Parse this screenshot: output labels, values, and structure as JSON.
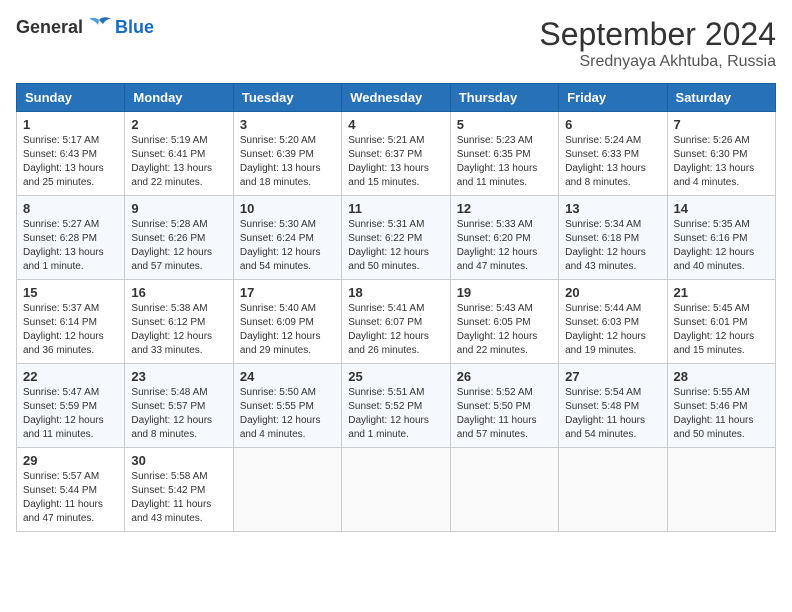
{
  "header": {
    "logo_general": "General",
    "logo_blue": "Blue",
    "month_title": "September 2024",
    "location": "Srednyaya Akhtuba, Russia"
  },
  "days_of_week": [
    "Sunday",
    "Monday",
    "Tuesday",
    "Wednesday",
    "Thursday",
    "Friday",
    "Saturday"
  ],
  "weeks": [
    [
      {
        "day": "1",
        "sunrise": "5:17 AM",
        "sunset": "6:43 PM",
        "daylight": "13 hours and 25 minutes."
      },
      {
        "day": "2",
        "sunrise": "5:19 AM",
        "sunset": "6:41 PM",
        "daylight": "13 hours and 22 minutes."
      },
      {
        "day": "3",
        "sunrise": "5:20 AM",
        "sunset": "6:39 PM",
        "daylight": "13 hours and 18 minutes."
      },
      {
        "day": "4",
        "sunrise": "5:21 AM",
        "sunset": "6:37 PM",
        "daylight": "13 hours and 15 minutes."
      },
      {
        "day": "5",
        "sunrise": "5:23 AM",
        "sunset": "6:35 PM",
        "daylight": "13 hours and 11 minutes."
      },
      {
        "day": "6",
        "sunrise": "5:24 AM",
        "sunset": "6:33 PM",
        "daylight": "13 hours and 8 minutes."
      },
      {
        "day": "7",
        "sunrise": "5:26 AM",
        "sunset": "6:30 PM",
        "daylight": "13 hours and 4 minutes."
      }
    ],
    [
      {
        "day": "8",
        "sunrise": "5:27 AM",
        "sunset": "6:28 PM",
        "daylight": "13 hours and 1 minute."
      },
      {
        "day": "9",
        "sunrise": "5:28 AM",
        "sunset": "6:26 PM",
        "daylight": "12 hours and 57 minutes."
      },
      {
        "day": "10",
        "sunrise": "5:30 AM",
        "sunset": "6:24 PM",
        "daylight": "12 hours and 54 minutes."
      },
      {
        "day": "11",
        "sunrise": "5:31 AM",
        "sunset": "6:22 PM",
        "daylight": "12 hours and 50 minutes."
      },
      {
        "day": "12",
        "sunrise": "5:33 AM",
        "sunset": "6:20 PM",
        "daylight": "12 hours and 47 minutes."
      },
      {
        "day": "13",
        "sunrise": "5:34 AM",
        "sunset": "6:18 PM",
        "daylight": "12 hours and 43 minutes."
      },
      {
        "day": "14",
        "sunrise": "5:35 AM",
        "sunset": "6:16 PM",
        "daylight": "12 hours and 40 minutes."
      }
    ],
    [
      {
        "day": "15",
        "sunrise": "5:37 AM",
        "sunset": "6:14 PM",
        "daylight": "12 hours and 36 minutes."
      },
      {
        "day": "16",
        "sunrise": "5:38 AM",
        "sunset": "6:12 PM",
        "daylight": "12 hours and 33 minutes."
      },
      {
        "day": "17",
        "sunrise": "5:40 AM",
        "sunset": "6:09 PM",
        "daylight": "12 hours and 29 minutes."
      },
      {
        "day": "18",
        "sunrise": "5:41 AM",
        "sunset": "6:07 PM",
        "daylight": "12 hours and 26 minutes."
      },
      {
        "day": "19",
        "sunrise": "5:43 AM",
        "sunset": "6:05 PM",
        "daylight": "12 hours and 22 minutes."
      },
      {
        "day": "20",
        "sunrise": "5:44 AM",
        "sunset": "6:03 PM",
        "daylight": "12 hours and 19 minutes."
      },
      {
        "day": "21",
        "sunrise": "5:45 AM",
        "sunset": "6:01 PM",
        "daylight": "12 hours and 15 minutes."
      }
    ],
    [
      {
        "day": "22",
        "sunrise": "5:47 AM",
        "sunset": "5:59 PM",
        "daylight": "12 hours and 11 minutes."
      },
      {
        "day": "23",
        "sunrise": "5:48 AM",
        "sunset": "5:57 PM",
        "daylight": "12 hours and 8 minutes."
      },
      {
        "day": "24",
        "sunrise": "5:50 AM",
        "sunset": "5:55 PM",
        "daylight": "12 hours and 4 minutes."
      },
      {
        "day": "25",
        "sunrise": "5:51 AM",
        "sunset": "5:52 PM",
        "daylight": "12 hours and 1 minute."
      },
      {
        "day": "26",
        "sunrise": "5:52 AM",
        "sunset": "5:50 PM",
        "daylight": "11 hours and 57 minutes."
      },
      {
        "day": "27",
        "sunrise": "5:54 AM",
        "sunset": "5:48 PM",
        "daylight": "11 hours and 54 minutes."
      },
      {
        "day": "28",
        "sunrise": "5:55 AM",
        "sunset": "5:46 PM",
        "daylight": "11 hours and 50 minutes."
      }
    ],
    [
      {
        "day": "29",
        "sunrise": "5:57 AM",
        "sunset": "5:44 PM",
        "daylight": "11 hours and 47 minutes."
      },
      {
        "day": "30",
        "sunrise": "5:58 AM",
        "sunset": "5:42 PM",
        "daylight": "11 hours and 43 minutes."
      },
      null,
      null,
      null,
      null,
      null
    ]
  ],
  "labels": {
    "sunrise": "Sunrise:",
    "sunset": "Sunset:",
    "daylight": "Daylight:"
  }
}
